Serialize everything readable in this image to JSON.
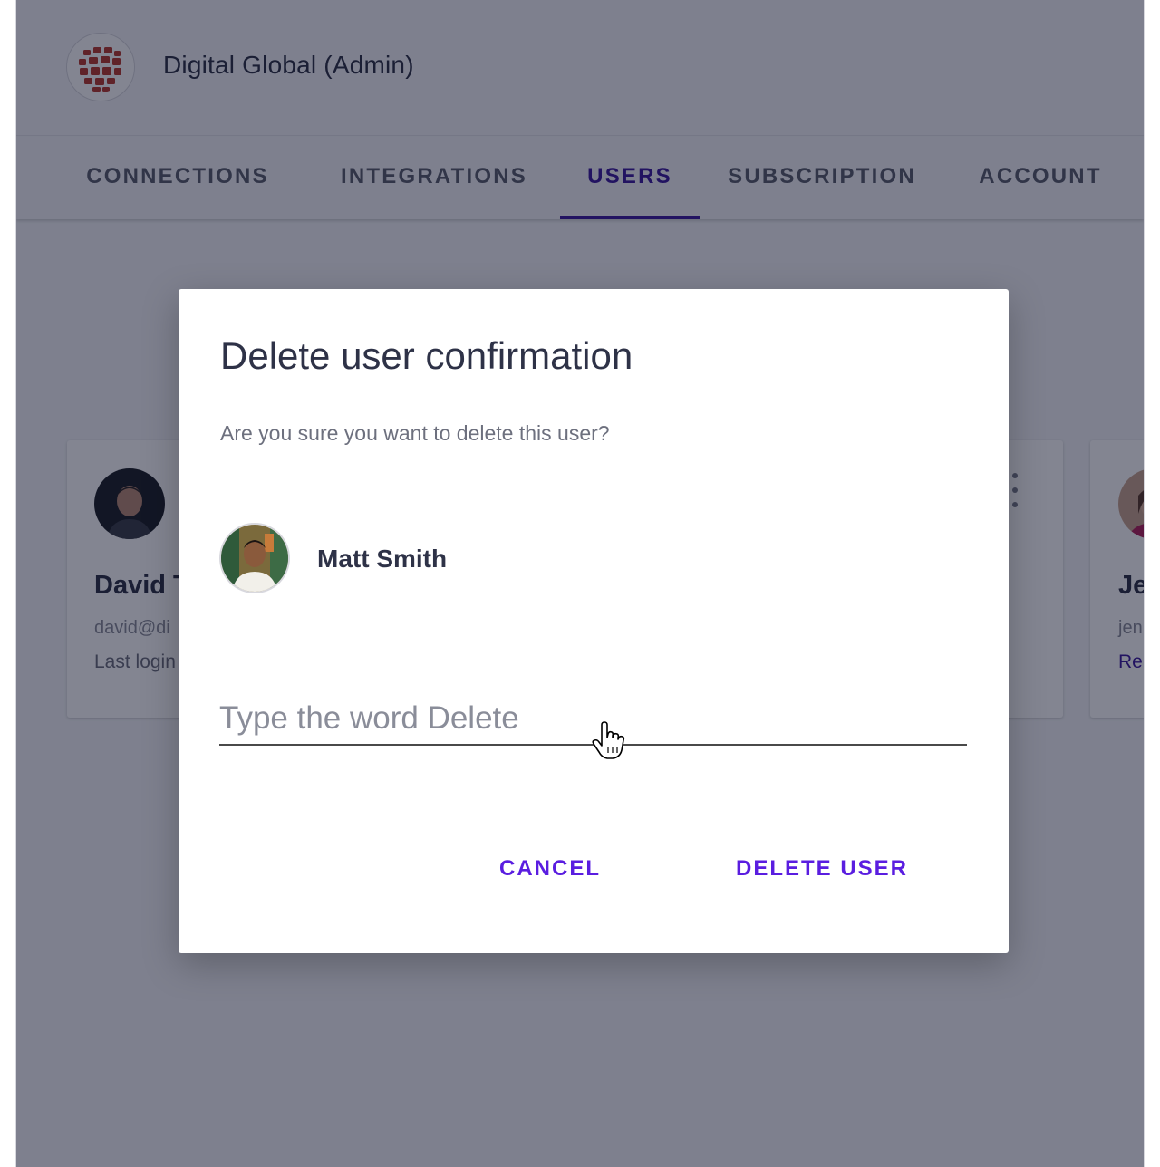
{
  "header": {
    "org_name": "Digital Global (Admin)",
    "logo_icon": "globe-logo-icon"
  },
  "tabs": [
    {
      "label": "CONNECTIONS",
      "active": false
    },
    {
      "label": "INTEGRATIONS",
      "active": false
    },
    {
      "label": "USERS",
      "active": true
    },
    {
      "label": "SUBSCRIPTION",
      "active": false
    },
    {
      "label": "ACCOUNT",
      "active": false
    }
  ],
  "background_cards": [
    {
      "name_visible": "David T",
      "email_visible": "david@di",
      "login_visible": "Last login"
    },
    {
      "name_visible": "Je",
      "email_visible": "jen",
      "link_visible": "Re"
    }
  ],
  "dialog": {
    "title": "Delete user confirmation",
    "message": "Are you sure you want to delete this user?",
    "user_name": "Matt Smith",
    "input": {
      "placeholder": "Type the word Delete",
      "value": ""
    },
    "cancel_label": "CANCEL",
    "delete_label": "DELETE USER"
  },
  "colors": {
    "accent": "#5a1de0",
    "active_tab": "#3d1a9e",
    "overlay": "rgba(8,12,35,0.50)"
  }
}
